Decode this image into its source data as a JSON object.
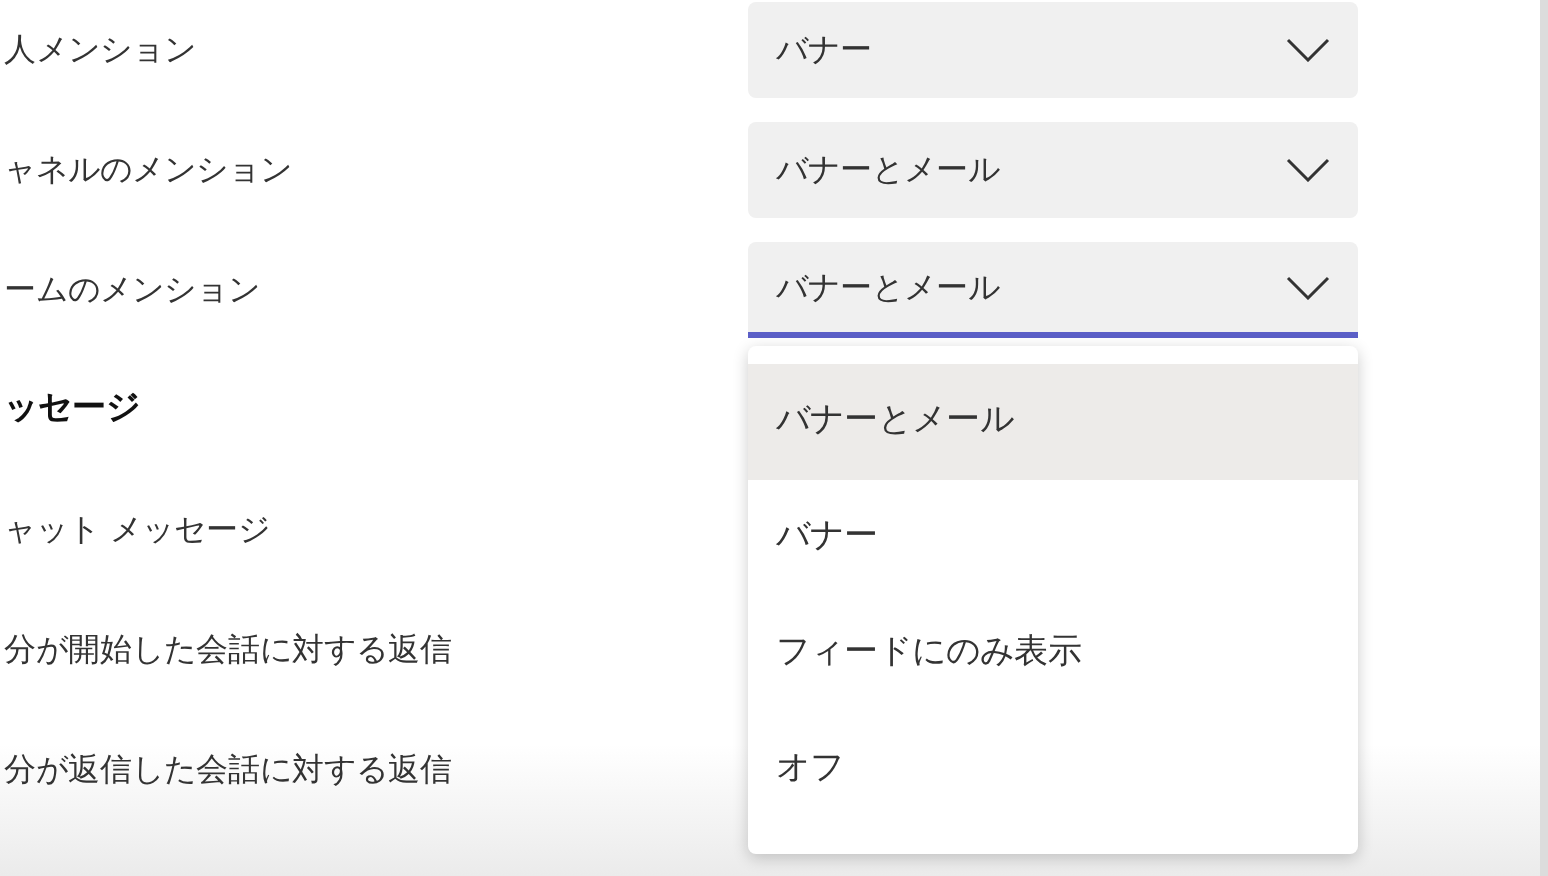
{
  "rows": [
    {
      "kind": "setting",
      "label": "人メンション",
      "value": "バナー",
      "open": false
    },
    {
      "kind": "setting",
      "label": "ャネルのメンション",
      "value": "バナーとメール",
      "open": false
    },
    {
      "kind": "setting",
      "label": "ームのメンション",
      "value": "バナーとメール",
      "open": true
    },
    {
      "kind": "heading",
      "label": "ッセージ"
    },
    {
      "kind": "setting",
      "label": "ャット メッセージ"
    },
    {
      "kind": "setting",
      "label": "分が開始した会話に対する返信"
    },
    {
      "kind": "setting",
      "label": "分が返信した会話に対する返信"
    }
  ],
  "menu": {
    "options": [
      {
        "label": "バナーとメール",
        "selected": true
      },
      {
        "label": "バナー",
        "selected": false
      },
      {
        "label": "フィードにのみ表示",
        "selected": false
      },
      {
        "label": "オフ",
        "selected": false
      }
    ]
  }
}
